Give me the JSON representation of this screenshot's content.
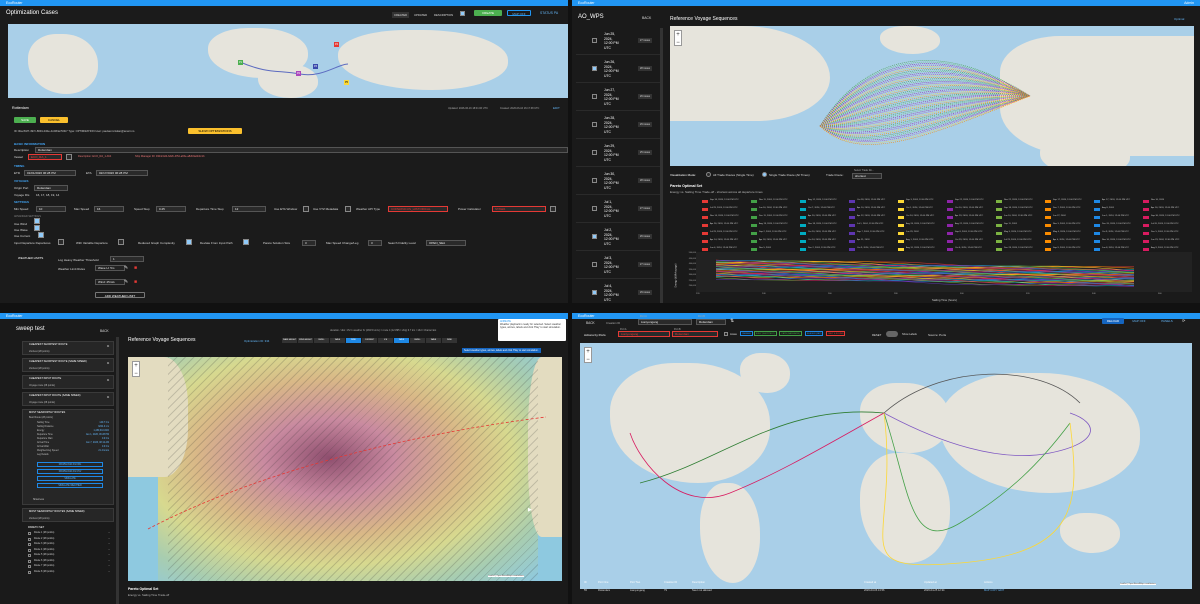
{
  "q1": {
    "app_name": "EcoRouter",
    "page_title": "Optimization Cases",
    "filters": [
      "CREATED",
      "UPDATED",
      "DESCRIPTION"
    ],
    "create_label": "CREATE",
    "map_off_label": "MAP OFF",
    "status_label": "STATUS PA",
    "case_name": "Rotterdam",
    "edit_label": "EDIT",
    "updated_text": "Updated: 2026-06-16 18:01:06 UTC",
    "created_text": "Created: 2026-06-16 16:17:38 UTC",
    "save_label": "SAVE",
    "cancel_label": "CANCEL",
    "id_line": "ID: 0bec81f7-497c-8691-b3be-4c23f4e7b0b7  Type: OPTIMIZATION  User: paulsen.kristian@ameri.no",
    "show_opt_label": "SHOW OPTIMIZATIONS",
    "basic_info_label": "BASIC INFORMATION",
    "description_label": "Description",
    "description_value": "Rotterdam",
    "vessel_label": "Vessel",
    "vessel_value": "ECO_RA_1",
    "vessel_desc": "Description: ECO_RA_1 Abb",
    "ship_manager": "Ship Manager ID: 03b3c4d4-6d2b-4f54-ab5e-a82b9a4b3c1b",
    "timing_label": "TIMING",
    "etd_label": "ETD",
    "etd_value": "01/01/2026 06:28 PM",
    "eta_label": "ETA",
    "eta_value": "02/17/2026 06:28 PM",
    "voyages_label": "VOYAGES",
    "origin_label": "Origin Port",
    "origin_value": "Rotterdam",
    "voyage_ids_label": "Voyage IDs",
    "voyage_ids_value": "16, 17, 18, 19, 14",
    "settings_label": "SETTINGS",
    "min_speed_label": "Min Speed",
    "min_speed": "10",
    "max_speed_label": "Max Speed",
    "max_speed": "16",
    "speed_step_label": "Speed Step",
    "speed_step": "0.25",
    "dep_step_label": "Departure Time Step",
    "dep_step": "12",
    "use_eta_label": "Use ETA Window",
    "use_vtz_label": "Use VTZ Metadata",
    "weather_api_label": "Weather API Type",
    "weather_api": "COPERNICUS_HISTORICAL",
    "power_calc_label": "Power Calculator",
    "power_calc": "STAWA",
    "advanced_label": "ADVANCED SETTINGS",
    "use_wind_label": "Use Wind",
    "use_wave_label": "Use Wave",
    "use_current_label": "Use Current",
    "input_dep_label": "Input Departure Departures",
    "variable_dep_label": "With Variable Departure",
    "reduced_graph_label": "Reduced Graph Complexity",
    "deviate_label": "Deviate From Input Path",
    "pareto_size_label": "Pareto Solution Size",
    "pareto_size": "3",
    "max_speed_change_label": "Max Speed Change/Leg",
    "max_speed_change": "3",
    "search_fidelity_label": "Search Fidelity Level",
    "search_fidelity": "OPEN_SEA",
    "weather_limits_label": "WEATHER LIMITS",
    "log_heavy_label": "Log Heavy Weather Threshold",
    "log_heavy_value": "1",
    "weather_limit_rules_label": "Weather Limit Rules",
    "wave_rule": "Wave H: 5m",
    "wind_rule": "Wind: 25m/s",
    "add_weather_label": "ADD WEATHER LIMIT",
    "port_labels": [
      "P1",
      "P2",
      "P3",
      "P4",
      "P5"
    ]
  },
  "q2": {
    "app_name": "EcoRouter",
    "right_bar_text": "Admin",
    "list_title": "AO_WPS",
    "back_label": "BACK",
    "map_title": "Reference Voyage Sequences",
    "optimal_label": "Optimal",
    "dates": [
      {
        "d": "Jun 25,",
        "y": "2024,",
        "t": "12:00 PM",
        "z": "UTC",
        "b": "27 routes"
      },
      {
        "d": "Jun 26,",
        "y": "2024,",
        "t": "12:00 PM",
        "z": "UTC",
        "b": "28 routes"
      },
      {
        "d": "Jun 27,",
        "y": "2024,",
        "t": "12:00 PM",
        "z": "UTC",
        "b": "26 routes"
      },
      {
        "d": "Jun 28,",
        "y": "2024,",
        "t": "12:00 PM",
        "z": "UTC",
        "b": "29 routes"
      },
      {
        "d": "Jun 29,",
        "y": "2024,",
        "t": "12:00 PM",
        "z": "UTC",
        "b": "25 routes"
      },
      {
        "d": "Jun 30,",
        "y": "2024,",
        "t": "12:00 PM",
        "z": "UTC",
        "b": "28 routes"
      },
      {
        "d": "Jul 1,",
        "y": "2024,",
        "t": "12:00 PM",
        "z": "UTC",
        "b": "27 routes"
      },
      {
        "d": "Jul 2,",
        "y": "2024,",
        "t": "12:00 PM",
        "z": "UTC",
        "b": "26 routes"
      },
      {
        "d": "Jul 3,",
        "y": "2024,",
        "t": "12:00 PM",
        "z": "UTC",
        "b": "27 routes"
      },
      {
        "d": "Jul 4,",
        "y": "2024,",
        "t": "12:00 PM",
        "z": "UTC",
        "b": "29 routes"
      }
    ],
    "vis_mode_label": "Visualization Mode:",
    "all_trade_label": "All Trade Routes (Single Time)",
    "single_trade_label": "Single Trade Route (All Times)",
    "trade_route_label": "Trade Route:",
    "trade_select_label": "Select Trade Ro...",
    "trade_select_value": "shortest",
    "pareto_title": "Pareto Optimal Set",
    "pareto_sub": "Energy vs. Sailing Time Trade-off - shortest across all departure times",
    "x_axis_label": "Sailing Time (hours)",
    "y_axis_label": "Energy (kWh/voyage)",
    "legend_entries": [
      "Sep 16, 2024, 12:00 PM UTC",
      "Nov 11, 2024, 12:00 PM UTC",
      "Aug 12, 2024, 12:00 PM UTC",
      "Oct 28, 2024, 12:00 PM UTC",
      "Sep 3, 2024, 12:00 PM UTC",
      "Sep 22, 2024, 12:00 PM UTC",
      "Nov 22, 2024, 12:00 PM UTC",
      "Sep 17, 2024, 12:00 PM UTC",
      "Apr 17, 2024, 12:00 PM UTC",
      "Nov 10, 2024",
      "Jul 29, 2024, 12:00 PM UTC",
      "Jun 16, 2024, 12:00 PM UTC",
      "Oct 7, 2024, 12:00 PM UTC",
      "Apr 10, 2024, 12:00 PM UTC",
      "Oct 1, 2024, 12:00 PM UTC",
      "Oct 10, 2024, 12:00 PM UTC",
      "Sep 18, 2024, 12:00 PM UTC",
      "Dec 7, 2024, 12:00 PM UTC",
      "Aug 8, 2024",
      "Apr 16, 2024, 12:00 PM UTC",
      "Nov 14, 2024, 12:00 PM UTC",
      "Dec 11, 2024, 12:00 PM UTC",
      "Apr 20, 2024, 12:00 PM UTC",
      "Apr 22, 2024, 12:00 PM UTC",
      "Oct 24, 2024, 12:00 PM UTC",
      "Apr 29, 2024, 12:00 PM UTC",
      "Jun 10, 2024, 12:00 PM UTC",
      "Jun 27, 2024",
      "Jun 1, 2024, 12:00 PM UTC",
      "Sep 30, 2024, 12:00 PM UTC",
      "Apr 26, 2024, 12:00 PM UTC",
      "Aug 19, 2024, 12:00 PM UTC",
      "Nov 18, 2024, 12:00 PM UTC",
      "Jul 1, 2024, 12:00 PM UTC",
      "Aug 26, 2024, 12:00 PM UTC",
      "Aug 22, 2024, 12:00 PM UTC",
      "Sep 11, 2024",
      "Nov 3, 2024, 12:00 PM UTC",
      "Dec 20, 2024, 12:00 PM UTC",
      "Jul 26, 2024, 12:00 PM UTC",
      "Jul 29, 2024, 12:00 PM UTC",
      "Sep 2, 2024, 12:00 PM UTC",
      "Oct 20, 2024, 12:00 PM UTC",
      "Sep 7, 2024, 12:00 PM UTC",
      "Jun 29, 2024",
      "Sep 8, 2024, 12:00 PM UTC",
      "May 5, 2024, 12:00 PM UTC",
      "May 4, 2024, 12:00 PM UTC",
      "Oct 9, 2024, 12:00 PM UTC",
      "Dec 5, 2024, 12:00 PM UTC",
      "Apr 14, 2024, 12:00 PM UTC",
      "Apr 18, 2024, 12:00 PM UTC",
      "Oct 24, 2024, 12:00 PM UTC",
      "Apr 21, 2024",
      "Aug 1, 2024, 12:00 PM UTC",
      "Oct 29, 2024, 12:00 PM UTC",
      "Jul 23, 2024, 12:00 PM UTC",
      "Apr 4, 2024, 12:00 PM UTC",
      "Nov 10, 2024, 12:00 PM UTC",
      "Jun 23, 2024, 12:00 PM UTC",
      "Jun 4, 2024, 12:00 PM UTC",
      "Nov 5, 2024",
      "Dec 2, 2024, 12:00 PM UTC",
      "Oct 9, 2024, 12:00 PM UTC",
      "Aug 31, 2024, 12:00 PM UTC",
      "Oct 6, 2024, 12:00 PM UTC",
      "Dec 28, 2024, 12:00 PM UTC",
      "Sep 9, 2024, 12:00 PM UTC",
      "Jun 8, 2024, 12:00 PM UTC",
      "Aug 9, 2024, 12:00 PM UTC",
      "Jul 17, 2024"
    ],
    "y_ticks": [
      "500,000",
      "450,000",
      "400,000",
      "350,000",
      "300,000",
      "250,000",
      "200,000"
    ],
    "x_ticks": [
      "220",
      "240",
      "260",
      "280",
      "300",
      "320",
      "340",
      "360"
    ]
  },
  "q3": {
    "app_name": "EcoRouter",
    "list_title": "sweep test",
    "back_label": "BACK",
    "routes": [
      {
        "title": "CHEAPEST SHORTEST ROUTE",
        "sub": "shortest (28 points)"
      },
      {
        "title": "CHEAPEST SHORTEST ROUTE (SAME SPEED)",
        "sub": "shortest (28 points)"
      },
      {
        "title": "CHEAPEST INPUT ROUTE",
        "sub": "Voyage route (28 points)"
      },
      {
        "title": "CHEAPEST INPUT ROUTE (SAME SPEED)",
        "sub": "Voyage route (28 points)"
      }
    ],
    "selected_title": "MOST SEAWORTHY ROUTES",
    "selected_sub": "Best Route (28 points)",
    "detail_rows": [
      "Sailing Time",
      "Sailing Distance",
      "Energy",
      "Departure Time",
      "Departure Wait",
      "Arrival Time",
      "Arrival Wait",
      "Weighted Avg Speed",
      "Leg Details"
    ],
    "detail_vals": [
      "149.7 hrs",
      "3204.0 nm",
      "1,289,310 kWh",
      "Jan 1, 2026, 06:28 PM",
      "0.0 hrs",
      "Jan 7, 2026, 08:12 AM",
      "0.0 hrs",
      "21.4 knots",
      ""
    ],
    "action_labels": [
      "DOWNLOAD AS KML",
      "DOWNLOAD AS CSV",
      "SIMULATE",
      "SIMULATE WEATHER"
    ],
    "show_less_label": "Show less",
    "route5_title": "MOST SEAWORTHY ROUTES (SAME SPEED)",
    "route5_sub": "shortest (28 points)",
    "pareto_set_label": "PARETO SET",
    "pareto_items": [
      "Route 1 (28 points)",
      "Route 2 (28 points)",
      "Route 3 (28 points)",
      "Route 4 (28 points)",
      "Route 5 (28 points)",
      "Route 6 (28 points)",
      "Route 7 (28 points)",
      "Route 8 (28 points)"
    ],
    "map_title": "Reference Voyage Sequences",
    "optimal_info": "Optimization ID: 334",
    "map_tabs": [
      "WAVE HEIGHT",
      "WIND HEIGHT",
      "SWELL",
      "WAVE",
      "WIND",
      "CURRENT",
      "ICE",
      "WAVE",
      "SWELL",
      "WAVE",
      "WIND"
    ],
    "duration_text": "duration / dist: 172.1 weather hr (284.5 km/s) = route 4 (12.895 / ship) 6.7 km / 13d  /  Charter Est",
    "tooltip_title": "ANIMATE",
    "tooltip_text": "Weather playback is ready for selected. Select weather types, arrows, labels and click 'Play' to start simulation.",
    "tooltip_hint": "Select weather types, arrows, labels and click 'Play' to start simulation.",
    "pareto_title": "Pareto Optimal Set",
    "pareto_sub": "Energy vs. Sailing Time Trade-off",
    "attribution": "Leaflet | OpenStreetMap contributors"
  },
  "q4": {
    "app_name": "EcoRouter",
    "back_label": "BACK",
    "creation_id_label": "Creation ID",
    "port_a_label": "Port A",
    "port_a_value": "Lianyungang",
    "port_b_label": "Port B",
    "port_b_value": "Rotterdam",
    "reload_label": "RELOAD",
    "map_off_label": "MAP OFF",
    "panels_label": "PANELS",
    "actions_label": "Actions by Ports",
    "port_a2_label": "Port A",
    "port_a2_value": "Lianyungang",
    "port_b2_label": "Port B",
    "port_b2_value": "Rotterdam",
    "areas_label": "Areas",
    "tags": [
      "PANAMA",
      "SUEZ (SHORTEST)",
      "CAPE (BARGAINS)",
      "SKAGEN (FAR)",
      "BELT & SOUND"
    ],
    "reset_label": "RESET",
    "show_labels": "Show Labels",
    "source_label": "Source: Ports",
    "table_headers": [
      "ID",
      "Port One",
      "Port Two",
      "Creation ID",
      "Description",
      "Created at",
      "Updated at",
      "Actions"
    ],
    "table_row": [
      "55",
      "Rotterdam",
      "Lianyungang",
      "79",
      "Suez not allowed",
      "2026-03-06 13:56",
      "2026-04-25 12:34",
      "MAP  COPY  EDIT"
    ],
    "attribution": "Leaflet | OpenStreetMap contributors"
  },
  "colors": {
    "accent": "#2196f3",
    "green": "#4caf50",
    "yellow": "#fbc02d",
    "red": "#e53935"
  },
  "icons": [
    "search-icon",
    "back-arrow-icon",
    "plus-icon",
    "minus-icon",
    "pencil-icon",
    "delete-icon",
    "check-icon",
    "play-icon",
    "pause-icon",
    "reload-icon"
  ]
}
